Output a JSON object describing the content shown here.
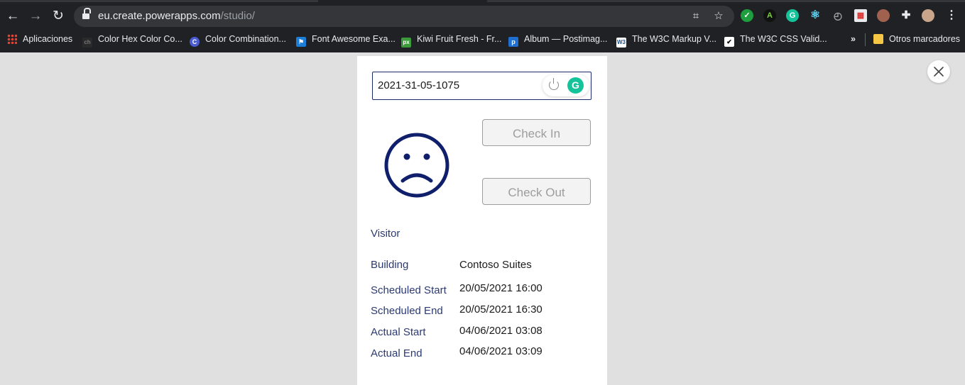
{
  "browser": {
    "url_host": "eu.create.powerapps.com",
    "url_path": "/studio/",
    "bookmarks": [
      {
        "label": "Aplicaciones",
        "icon": "apps-grid-icon",
        "color": "#ea4335"
      },
      {
        "label": "Color Hex Color Co...",
        "icon": "colorhex-icon",
        "color": "#444444"
      },
      {
        "label": "Color Combination...",
        "icon": "c-circle-icon",
        "color": "#4a5bd4"
      },
      {
        "label": "Font Awesome Exa...",
        "icon": "flag-icon",
        "color": "#1c7ed6"
      },
      {
        "label": "Kiwi Fruit Fresh - Fr...",
        "icon": "px-icon",
        "color": "#3b9b3b"
      },
      {
        "label": "Album — Postimag...",
        "icon": "p-icon",
        "color": "#1f6fd1"
      },
      {
        "label": "The W3C Markup V...",
        "icon": "w3c-icon",
        "color": "#ffffff"
      },
      {
        "label": "The W3C CSS Valid...",
        "icon": "css-valid-icon",
        "color": "#ffffff"
      }
    ],
    "other_bookmarks": "Otros marcadores"
  },
  "app": {
    "search_value": "2021-31-05-1075",
    "check_in_label": "Check In",
    "check_out_label": "Check Out",
    "visitor_label": "Visitor",
    "rows": [
      {
        "label": "Building",
        "value": "Contoso Suites"
      },
      {
        "label": "Scheduled Start",
        "value": "20/05/2021 16:00"
      },
      {
        "label": "Scheduled End",
        "value": "20/05/2021 16:30"
      },
      {
        "label": "Actual Start",
        "value": "04/06/2021 03:08"
      },
      {
        "label": "Actual End",
        "value": "04/06/2021 03:09"
      }
    ],
    "status_icon": "sad-face-icon",
    "accent_color": "#0f1f6b"
  }
}
